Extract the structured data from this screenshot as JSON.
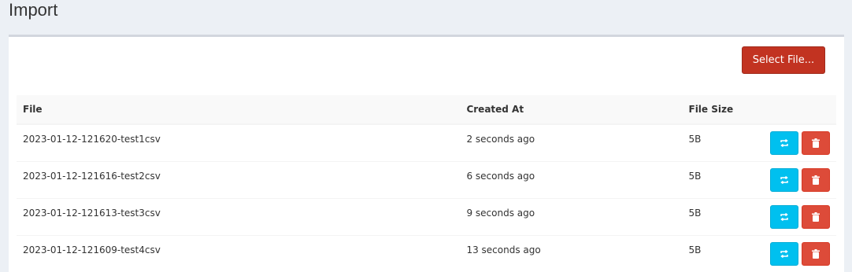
{
  "page": {
    "title": "Import"
  },
  "toolbar": {
    "select_label": "Select File..."
  },
  "table": {
    "headers": {
      "file": "File",
      "created": "Created At",
      "size": "File Size"
    },
    "rows": [
      {
        "file": "2023-01-12-121620-test1csv",
        "created": "2 seconds ago",
        "size": "5B"
      },
      {
        "file": "2023-01-12-121616-test2csv",
        "created": "6 seconds ago",
        "size": "5B"
      },
      {
        "file": "2023-01-12-121613-test3csv",
        "created": "9 seconds ago",
        "size": "5B"
      },
      {
        "file": "2023-01-12-121609-test4csv",
        "created": "13 seconds ago",
        "size": "5B"
      }
    ]
  },
  "icons": {
    "reimport": "refresh-arrows-icon",
    "delete": "trash-icon"
  },
  "colors": {
    "select_button": "#c23321",
    "reimport_button": "#00c0ef",
    "delete_button": "#dd4b39"
  }
}
